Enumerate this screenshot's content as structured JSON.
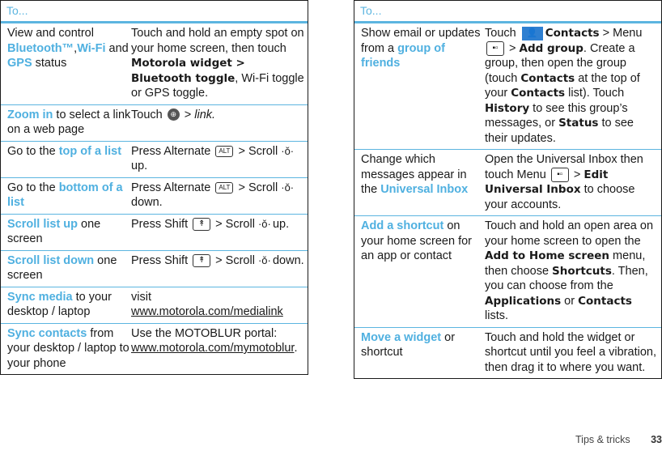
{
  "left_table": {
    "header": "To...",
    "rows": [
      {
        "c1": [
          {
            "t": "View and control "
          },
          {
            "t": "Bluetooth™",
            "hl": true
          },
          {
            "t": ","
          },
          {
            "t": "Wi-Fi",
            "hl": true
          },
          {
            "t": " and "
          },
          {
            "t": "GPS",
            "hl": true
          },
          {
            "t": " status"
          }
        ],
        "c2": [
          {
            "t": "Touch and hold an empty spot on your home screen, then touch "
          },
          {
            "t": "Motorola widget > Bluetooth toggle",
            "b": true
          },
          {
            "t": ", Wi-Fi toggle or GPS toggle."
          }
        ]
      },
      {
        "c1": [
          {
            "t": "Zoom in",
            "hl": true
          },
          {
            "t": " to select a link on a web page"
          }
        ],
        "c2": [
          {
            "t": "Touch "
          },
          {
            "icon": "zoom-icon"
          },
          {
            "t": " > "
          },
          {
            "t": "link.",
            "i": true
          }
        ]
      },
      {
        "c1": [
          {
            "t": "Go to the "
          },
          {
            "t": "top of a list",
            "hl": true
          }
        ],
        "c2": [
          {
            "t": "Press Alternate "
          },
          {
            "icon": "alt-key-icon"
          },
          {
            "t": " > Scroll "
          },
          {
            "icon": "scroll-icon"
          },
          {
            "t": " up."
          }
        ]
      },
      {
        "c1": [
          {
            "t": "Go to the "
          },
          {
            "t": "bottom of a list",
            "hl": true
          }
        ],
        "c2": [
          {
            "t": "Press Alternate "
          },
          {
            "icon": "alt-key-icon"
          },
          {
            "t": " > Scroll "
          },
          {
            "icon": "scroll-icon"
          },
          {
            "t": " down."
          }
        ]
      },
      {
        "c1": [
          {
            "t": "Scroll list up",
            "hl": true
          },
          {
            "t": " one screen"
          }
        ],
        "c2": [
          {
            "t": "Press Shift "
          },
          {
            "icon": "shift-key-icon"
          },
          {
            "t": " > Scroll "
          },
          {
            "icon": "scroll-icon"
          },
          {
            "t": " up."
          }
        ]
      },
      {
        "c1": [
          {
            "t": "Scroll list down",
            "hl": true
          },
          {
            "t": " one screen"
          }
        ],
        "c2": [
          {
            "t": "Press Shift "
          },
          {
            "icon": "shift-key-icon"
          },
          {
            "t": " > Scroll "
          },
          {
            "icon": "scroll-icon"
          },
          {
            "t": " down."
          }
        ]
      },
      {
        "c1": [
          {
            "t": "Sync media",
            "hl": true
          },
          {
            "t": " to your desktop / laptop"
          }
        ],
        "c2": [
          {
            "t": "visit "
          },
          {
            "t": "www.motorola.com/medialink",
            "u": true
          }
        ]
      },
      {
        "c1": [
          {
            "t": "Sync contacts",
            "hl": true
          },
          {
            "t": " from your desktop / laptop to your phone"
          }
        ],
        "c2": [
          {
            "t": "Use the MOTOBLUR portal: "
          },
          {
            "t": "www.motorola.com/mymotoblur",
            "u": true
          },
          {
            "t": "."
          }
        ]
      }
    ]
  },
  "right_table": {
    "header": "To...",
    "rows": [
      {
        "c1": [
          {
            "t": "Show email or updates from a "
          },
          {
            "t": "group of friends",
            "hl": true
          }
        ],
        "c2": [
          {
            "t": "Touch "
          },
          {
            "icon": "contacts-icon"
          },
          {
            "t": "Contacts",
            "b": true
          },
          {
            "t": " > Menu "
          },
          {
            "icon": "menu-key-icon"
          },
          {
            "t": " > "
          },
          {
            "t": "Add group",
            "b": true
          },
          {
            "t": ". Create a group, then open the group (touch "
          },
          {
            "t": "Contacts",
            "b": true
          },
          {
            "t": " at the top of your "
          },
          {
            "t": "Contacts",
            "b": true
          },
          {
            "t": " list). Touch "
          },
          {
            "t": "History",
            "b": true
          },
          {
            "t": " to see this group’s messages, or "
          },
          {
            "t": "Status",
            "b": true
          },
          {
            "t": " to see their updates."
          }
        ]
      },
      {
        "c1": [
          {
            "t": "Change which messages appear in the "
          },
          {
            "t": "Universal Inbox",
            "hl": true
          }
        ],
        "c2": [
          {
            "t": "Open the Universal Inbox then touch Menu "
          },
          {
            "icon": "menu-key-icon"
          },
          {
            "t": " > "
          },
          {
            "t": "Edit Universal Inbox",
            "b": true
          },
          {
            "t": " to choose your accounts."
          }
        ]
      },
      {
        "c1": [
          {
            "t": "Add a shortcut",
            "hl": true
          },
          {
            "t": " on your home screen for an app or contact"
          }
        ],
        "c2": [
          {
            "t": "Touch and hold an open area on your home screen to open the "
          },
          {
            "t": "Add to Home screen",
            "b": true
          },
          {
            "t": " menu, then choose "
          },
          {
            "t": "Shortcuts",
            "b": true
          },
          {
            "t": ". Then, you can choose from the "
          },
          {
            "t": "Applications",
            "b": true
          },
          {
            "t": " or "
          },
          {
            "t": "Contacts",
            "b": true
          },
          {
            "t": " lists."
          }
        ]
      },
      {
        "c1": [
          {
            "t": "Move a widget",
            "hl": true
          },
          {
            "t": " or shortcut"
          }
        ],
        "c2": [
          {
            "t": "Touch and hold the widget or shortcut until you feel a vibration, then drag it to where you want."
          }
        ]
      }
    ]
  },
  "icons": {
    "zoom-icon": "⊕",
    "alt-key-icon": "ALT",
    "shift-key-icon": "↟",
    "scroll-icon": "·ǒ·",
    "menu-key-icon": "▪▫",
    "contacts-icon": "👤"
  },
  "footer": {
    "section": "Tips & tricks",
    "page": "33"
  },
  "colors": {
    "accent": "#4fb0e0",
    "rule": "#5cb5e0",
    "text": "#1a1a1a"
  }
}
